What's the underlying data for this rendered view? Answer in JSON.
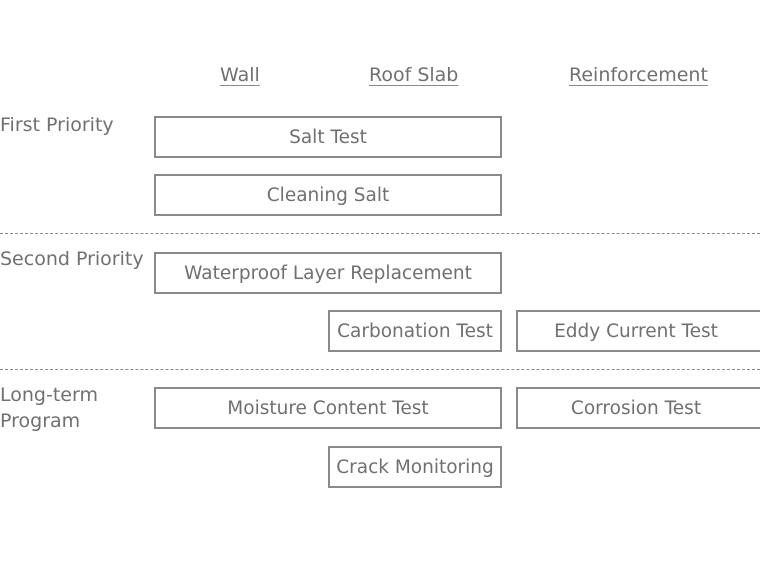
{
  "columns": {
    "wall": "Wall",
    "roof_slab": "Roof Slab",
    "reinforcement": "Reinforcement"
  },
  "rows": {
    "first": "First Priority",
    "second": "Second Priority",
    "longterm_line1": "Long-term",
    "longterm_line2": "Program"
  },
  "tasks": {
    "salt_test": "Salt Test",
    "cleaning_salt": "Cleaning Salt",
    "waterproof": "Waterproof Layer Replacement",
    "carbonation": "Carbonation Test",
    "eddy_current": "Eddy Current Test",
    "moisture": "Moisture Content Test",
    "corrosion": "Corrosion Test",
    "crack": "Crack Monitoring"
  },
  "colors": {
    "text": "#707070",
    "border": "#8a8a8a"
  }
}
